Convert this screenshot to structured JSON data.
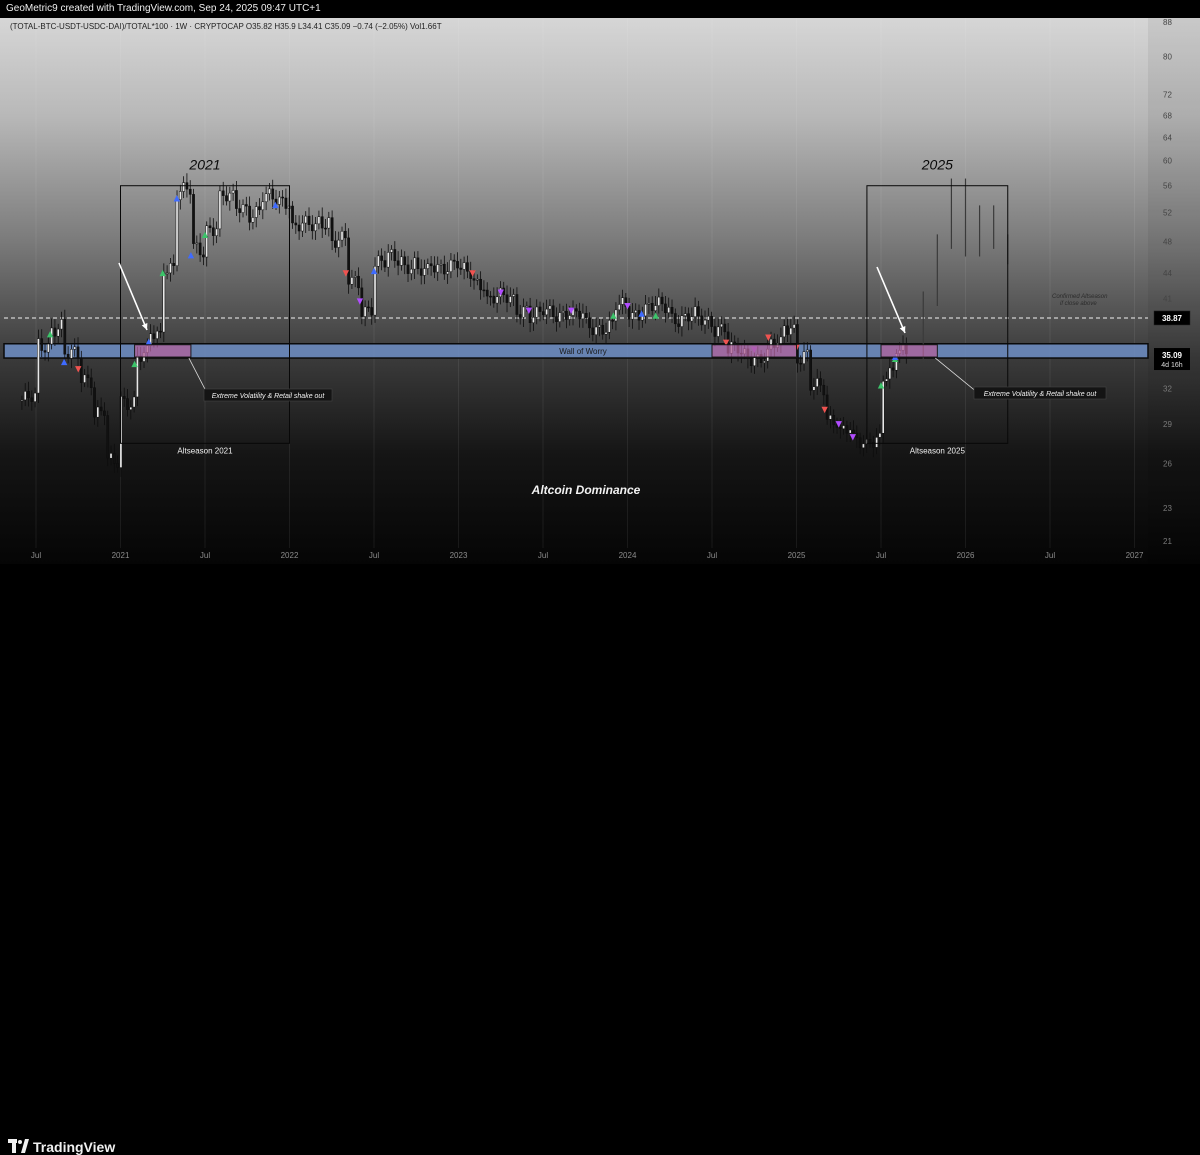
{
  "header": {
    "attribution": "GeoMetric9 created with TradingView.com, Sep 24, 2025 09:47 UTC+1",
    "legend": "(TOTAL-BTC-USDT-USDC-DAI)/TOTAL*100 · 1W · CRYPTOCAP  O35.82  H35.9  L34.41  C35.09  −0.74 (−2.05%)  Vol1.66T"
  },
  "footer": {
    "brand": "TradingView",
    "logo_icon": "tradingview-logo-icon"
  },
  "colors": {
    "bull_marker": "#3cc46a",
    "bear_marker": "#ef5350",
    "blue_marker": "#3f6bff",
    "purple_marker": "#b14cff",
    "zone_band": "#6e8fc7",
    "zone_box": "#b0609a"
  },
  "chart_data": {
    "type": "candlestick",
    "symbol": "(TOTAL-BTC-USDT-USDC-DAI)/TOTAL*100",
    "interval": "1W",
    "exchange": "CRYPTOCAP",
    "ohlc": {
      "open": 35.82,
      "high": 35.9,
      "low": 34.41,
      "close": 35.09,
      "change": -0.74,
      "change_pct": -2.05,
      "volume": "1.66T"
    },
    "x_ticks": [
      "Jul",
      "2021",
      "Jul",
      "2022",
      "Jul",
      "2023",
      "Jul",
      "2024",
      "Jul",
      "2025",
      "Jul",
      "2026",
      "Jul",
      "2027"
    ],
    "y_ticks": [
      88,
      80,
      72,
      68,
      64,
      60,
      56,
      52,
      48,
      44,
      41,
      38,
      35,
      32,
      29,
      26,
      23,
      21
    ],
    "y_scale": "log",
    "ylim": [
      21,
      88
    ],
    "price_labels": [
      {
        "value": 38.87,
        "text": "38.87"
      },
      {
        "value": 35.09,
        "text": "35.09",
        "sub": "4d 16h"
      }
    ],
    "series_close": [
      [
        "2020-06",
        31
      ],
      [
        "2020-07",
        36
      ],
      [
        "2020-08",
        38
      ],
      [
        "2020-09",
        35
      ],
      [
        "2020-10",
        33
      ],
      [
        "2020-11",
        30
      ],
      [
        "2020-12",
        26
      ],
      [
        "2021-01",
        31
      ],
      [
        "2021-02",
        35
      ],
      [
        "2021-03",
        37
      ],
      [
        "2021-04",
        45
      ],
      [
        "2021-05",
        55
      ],
      [
        "2021-06",
        47
      ],
      [
        "2021-07",
        50
      ],
      [
        "2021-08",
        54
      ],
      [
        "2021-09",
        53
      ],
      [
        "2021-10",
        52
      ],
      [
        "2021-11",
        54
      ],
      [
        "2021-12",
        54
      ],
      [
        "2022-01",
        50
      ],
      [
        "2022-02",
        50
      ],
      [
        "2022-03",
        51
      ],
      [
        "2022-04",
        48
      ],
      [
        "2022-05",
        43
      ],
      [
        "2022-06",
        40
      ],
      [
        "2022-07",
        45
      ],
      [
        "2022-08",
        46
      ],
      [
        "2022-09",
        45
      ],
      [
        "2022-10",
        44
      ],
      [
        "2022-11",
        45
      ],
      [
        "2022-12",
        45
      ],
      [
        "2023-01",
        44
      ],
      [
        "2023-02",
        43
      ],
      [
        "2023-03",
        41
      ],
      [
        "2023-04",
        41
      ],
      [
        "2023-05",
        40
      ],
      [
        "2023-06",
        39
      ],
      [
        "2023-07",
        39.5
      ],
      [
        "2023-08",
        39.5
      ],
      [
        "2023-09",
        39
      ],
      [
        "2023-10",
        38
      ],
      [
        "2023-11",
        38
      ],
      [
        "2023-12",
        40
      ],
      [
        "2024-01",
        39.5
      ],
      [
        "2024-02",
        40
      ],
      [
        "2024-03",
        40
      ],
      [
        "2024-04",
        39
      ],
      [
        "2024-05",
        39
      ],
      [
        "2024-06",
        38.5
      ],
      [
        "2024-07",
        38
      ],
      [
        "2024-08",
        35.5
      ],
      [
        "2024-09",
        35
      ],
      [
        "2024-10",
        35
      ],
      [
        "2024-11",
        36
      ],
      [
        "2024-12",
        38
      ],
      [
        "2025-01",
        35
      ],
      [
        "2025-02",
        32
      ],
      [
        "2025-03",
        29.5
      ],
      [
        "2025-04",
        28.5
      ],
      [
        "2025-05",
        27.5
      ],
      [
        "2025-06",
        28
      ],
      [
        "2025-07",
        33
      ],
      [
        "2025-08",
        35.5
      ],
      [
        "2025-09",
        35.09
      ]
    ],
    "projection": [
      [
        "2025-09",
        35.09
      ],
      [
        "2025-10",
        41
      ],
      [
        "2025-11",
        48
      ],
      [
        "2025-12",
        56
      ],
      [
        "2026-01",
        47
      ],
      [
        "2026-02",
        52
      ],
      [
        "2026-03",
        48
      ],
      [
        "2026-04",
        46
      ]
    ],
    "annotations": {
      "box_2021": {
        "label": "2021",
        "caption": "Altseason 2021",
        "from": "2021-01",
        "to": "2022-01",
        "y_top": 56,
        "y_bottom": 27.5
      },
      "box_2025": {
        "label": "2025",
        "caption": "Altseason 2025",
        "from": "2025-06",
        "to": "2026-04",
        "y_top": 56,
        "y_bottom": 27.5
      },
      "wall_band": {
        "label": "Wall of Worry",
        "y_top": 36.2,
        "y_bottom": 34.8
      },
      "confirm_line": {
        "value": 38.87,
        "text1": "Confirmed Altseason",
        "text2": "if close above"
      },
      "shake_left": {
        "text": "Extreme Volatility & Retail shake out"
      },
      "shake_right": {
        "text": "Extreme Volatility & Retail shake out"
      },
      "center_title": "Altcoin Dominance"
    }
  }
}
